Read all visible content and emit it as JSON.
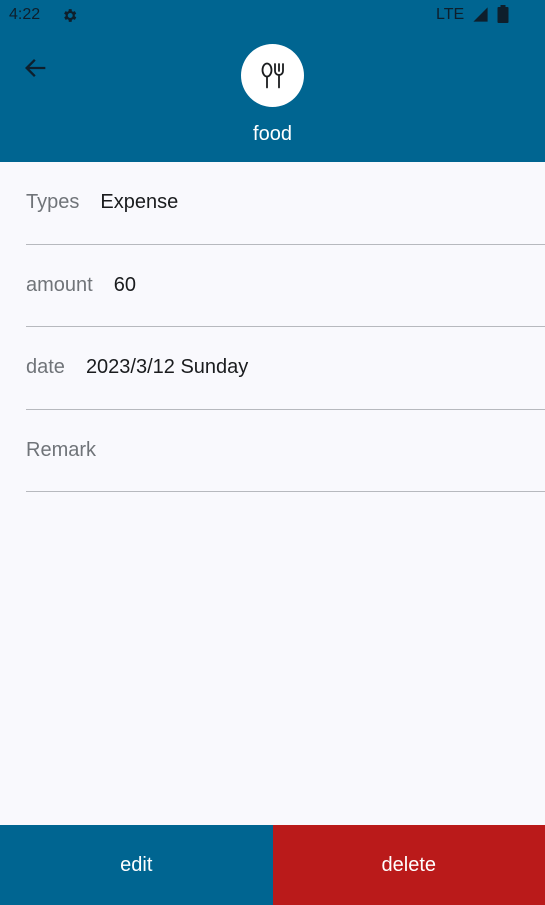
{
  "status_bar": {
    "time": "4:22",
    "network": "LTE",
    "icons": [
      "gear-icon",
      "signal-icon",
      "battery-icon"
    ]
  },
  "header": {
    "back_icon": "arrow-back-icon",
    "category_icon": "restaurant-icon",
    "category_name": "food"
  },
  "details": {
    "type": {
      "label": "Types",
      "value": "Expense"
    },
    "amount": {
      "label": "amount",
      "value": "60"
    },
    "date": {
      "label": "date",
      "value": "2023/3/12 Sunday"
    },
    "remark": {
      "label": "Remark",
      "value": ""
    }
  },
  "actions": {
    "edit_label": "edit",
    "delete_label": "delete"
  },
  "colors": {
    "primary": "#006591",
    "danger": "#ba1a1a",
    "background": "#f9f9fd"
  }
}
